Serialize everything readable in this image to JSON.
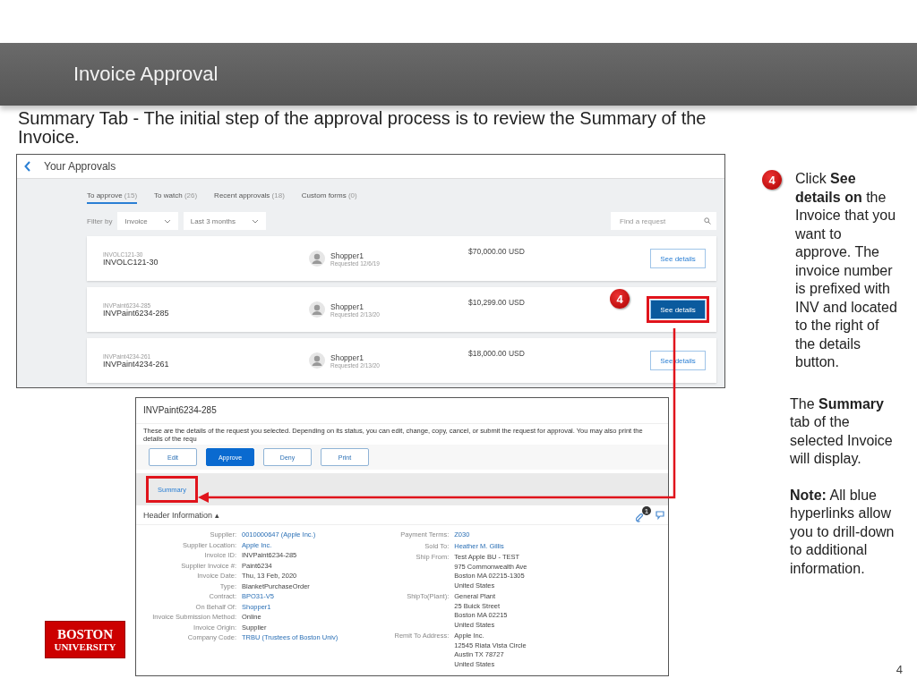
{
  "header": {
    "title": "Invoice Approval"
  },
  "subtitle": "Summary Tab - The initial step of the approval process is to review the Summary of the Invoice.",
  "approvals": {
    "title": "Your Approvals",
    "tabs": [
      {
        "label": "To approve",
        "count": "(15)",
        "selected": true
      },
      {
        "label": "To watch",
        "count": "(26)",
        "selected": false
      },
      {
        "label": "Recent approvals",
        "count": "(18)",
        "selected": false
      },
      {
        "label": "Custom forms",
        "count": "(0)",
        "selected": false
      }
    ],
    "filter_label": "Filter by",
    "filters": [
      "Invoice",
      "Last 3 months"
    ],
    "search": {
      "placeholder": "Find a request"
    },
    "requests": [
      {
        "small_id": "INVOLC121-30",
        "id": "INVOLC121-30",
        "requester": "Shopper1",
        "requested": "Requested 12/6/19",
        "amount": "$70,000.00 USD",
        "button": "See details",
        "selected": false
      },
      {
        "small_id": "INVPaint6234-285",
        "id": "INVPaint6234-285",
        "requester": "Shopper1",
        "requested": "Requested 2/13/20",
        "amount": "$10,299.00 USD",
        "button": "See details",
        "selected": true,
        "callout": "4"
      },
      {
        "small_id": "INVPaint4234-261",
        "id": "INVPaint4234-261",
        "requester": "Shopper1",
        "requested": "Requested 2/13/20",
        "amount": "$18,000.00 USD",
        "button": "See details",
        "selected": false
      }
    ]
  },
  "details": {
    "title": "INVPaint6234-285",
    "description": "These are the details of the request you selected. Depending on its status, you can edit, change, copy, cancel, or submit the request for approval. You may also print the details of the requ",
    "buttons": [
      {
        "label": "Edit",
        "primary": false
      },
      {
        "label": "Approve",
        "primary": true
      },
      {
        "label": "Deny",
        "primary": false
      },
      {
        "label": "Print",
        "primary": false
      }
    ],
    "tabs": [
      {
        "label": "Summary",
        "selected": true
      }
    ],
    "section": "Header Information",
    "section_toggle": "▴",
    "left_fields": [
      {
        "label": "Supplier:",
        "lines": [
          "0010000647 (Apple Inc.)"
        ],
        "link": true
      },
      {
        "label": "Supplier Location:",
        "lines": [
          "Apple Inc."
        ],
        "link": true
      },
      {
        "label": "Invoice ID:",
        "lines": [
          "INVPaint6234-285"
        ],
        "link": false
      },
      {
        "label": "Supplier Invoice #:",
        "lines": [
          "Paint6234"
        ],
        "link": false
      },
      {
        "label": "Invoice Date:",
        "lines": [
          "Thu, 13 Feb, 2020"
        ],
        "link": false
      },
      {
        "label": "Type:",
        "lines": [
          "BlanketPurchaseOrder"
        ],
        "link": false
      },
      {
        "label": "Contract:",
        "lines": [
          "BPO31-V5"
        ],
        "link": true
      },
      {
        "label": "On Behalf Of:",
        "lines": [
          "Shopper1"
        ],
        "link": true
      },
      {
        "label": "Invoice Submission Method:",
        "lines": [
          "Online"
        ],
        "link": false
      },
      {
        "label": "Invoice Origin:",
        "lines": [
          "Supplier"
        ],
        "link": false
      },
      {
        "label": "Company Code:",
        "lines": [
          "TRBU (Trustees of Boston Univ)"
        ],
        "link": true
      }
    ],
    "right_fields": [
      {
        "label": "Payment Terms:",
        "lines": [
          "Z030"
        ],
        "link": true
      },
      {
        "label": "Sold To:",
        "lines": [
          "Heather M. Gillis"
        ],
        "link": true
      },
      {
        "label": "Ship From:",
        "lines": [
          "Test Apple BU - TEST",
          "975 Commonwealth Ave",
          "Boston MA 02215-1305",
          "United States"
        ],
        "link": false
      },
      {
        "label": "ShipTo(Plant):",
        "lines": [
          "General Plant",
          "25 Buick Street",
          "Boston MA 02215",
          "United States"
        ],
        "link": false
      },
      {
        "label": "Remit To Address:",
        "lines": [
          "Apple Inc.",
          "12545 Riata Vista Circle",
          "Austin TX 78727",
          "United States"
        ],
        "link": false
      }
    ],
    "attachment_count": "1"
  },
  "notes": [
    {
      "callout": "4",
      "text": "Click **See details on** the Invoice that you want to approve. The invoice number is prefixed with INV and located to the right of the details button."
    },
    {
      "text": "The **Summary** tab of the selected Invoice will display."
    },
    {
      "text": "**Note:** All blue hyperlinks allow you to drill-down to additional information."
    }
  ],
  "logo": [
    "BOSTON",
    "UNIVERSITY"
  ],
  "page_number": "4"
}
